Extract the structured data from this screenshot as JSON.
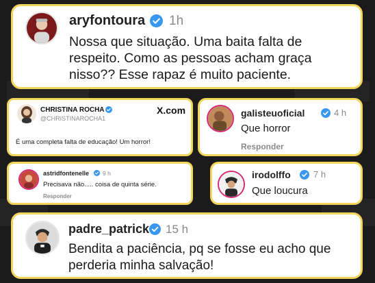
{
  "comments": {
    "aryfontoura": {
      "username": "aryfontoura",
      "time": "1h",
      "text": "Nossa que situação. Uma baita falta de respeito. Como as pessoas acham graça nisso?? Esse rapaz é muito paciente."
    },
    "christina": {
      "display_name": "CHRISTINA ROCHA",
      "handle": "@CHRISTINAROCHA1",
      "source": "X.com",
      "text": "É uma completa falta de educação! Um horror!"
    },
    "galisteu": {
      "username": "galisteuoficial",
      "time": "4 h",
      "text": "Que horror",
      "reply": "Responder"
    },
    "astrid": {
      "username": "astridfontenelle",
      "time": "9 h",
      "text": "Precisava não..... coisa de quinta série.",
      "reply": "Responder"
    },
    "irodolffo": {
      "username": "irodolffo",
      "time": "7 h",
      "text": "Que loucura"
    },
    "padre": {
      "username": "padre_patrick",
      "time": "15 h",
      "text": "Bendita a paciência, pq se fosse eu acho que perderia minha salvação!"
    }
  },
  "colors": {
    "card_border": "#f2d65c",
    "verified": "#3897f0",
    "background": "#1d1d1d"
  },
  "icons": {
    "verified": "verified-badge-icon"
  }
}
